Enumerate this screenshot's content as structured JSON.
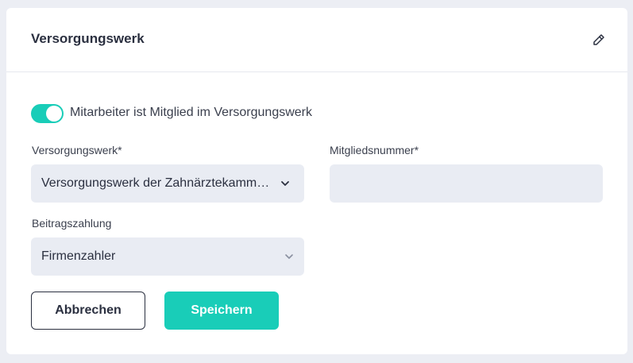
{
  "card": {
    "title": "Versorgungswerk",
    "edit_icon": "pencil-icon"
  },
  "toggle": {
    "checked": true,
    "label": "Mitarbeiter ist Mitglied im Versorgungswerk",
    "accent": "#19cdb8"
  },
  "fields": {
    "versorgungswerk": {
      "label": "Versorgungswerk*",
      "value": "Versorgungswerk der Zahnärztekamm…"
    },
    "mitgliedsnummer": {
      "label": "Mitgliedsnummer*",
      "value": ""
    },
    "beitragszahlung": {
      "label": "Beitragszahlung",
      "value": "Firmenzahler"
    }
  },
  "buttons": {
    "cancel": "Abbrechen",
    "save": "Speichern"
  }
}
